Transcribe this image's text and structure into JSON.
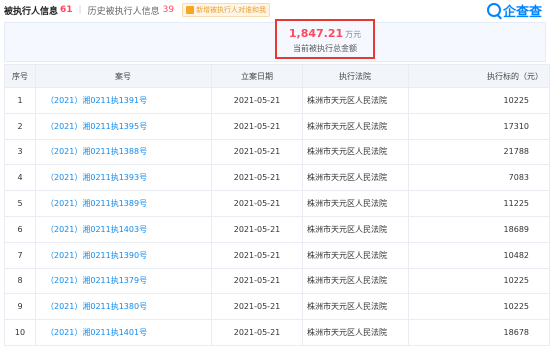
{
  "header": {
    "title": "被执行人信息",
    "title_count": "61",
    "history_label": "历史被执行人信息",
    "history_count": "39",
    "tag_label": "新增被执行人对谁和我",
    "logo_text": "企查查"
  },
  "summary": {
    "amount": "1,847.21",
    "unit": "万元",
    "label": "当前被执行总金额"
  },
  "table": {
    "headers": [
      "序号",
      "案号",
      "立案日期",
      "执行法院",
      "执行标的（元）"
    ],
    "rows": [
      {
        "idx": "1",
        "case": "（2021）湘0211执1391号",
        "date": "2021-05-21",
        "court": "株洲市天元区人民法院",
        "target": "10225"
      },
      {
        "idx": "2",
        "case": "（2021）湘0211执1395号",
        "date": "2021-05-21",
        "court": "株洲市天元区人民法院",
        "target": "17310"
      },
      {
        "idx": "3",
        "case": "（2021）湘0211执1388号",
        "date": "2021-05-21",
        "court": "株洲市天元区人民法院",
        "target": "21788"
      },
      {
        "idx": "4",
        "case": "（2021）湘0211执1393号",
        "date": "2021-05-21",
        "court": "株洲市天元区人民法院",
        "target": "7083"
      },
      {
        "idx": "5",
        "case": "（2021）湘0211执1389号",
        "date": "2021-05-21",
        "court": "株洲市天元区人民法院",
        "target": "11225"
      },
      {
        "idx": "6",
        "case": "（2021）湘0211执1403号",
        "date": "2021-05-21",
        "court": "株洲市天元区人民法院",
        "target": "18689"
      },
      {
        "idx": "7",
        "case": "（2021）湘0211执1390号",
        "date": "2021-05-21",
        "court": "株洲市天元区人民法院",
        "target": "10482"
      },
      {
        "idx": "8",
        "case": "（2021）湘0211执1379号",
        "date": "2021-05-21",
        "court": "株洲市天元区人民法院",
        "target": "10225"
      },
      {
        "idx": "9",
        "case": "（2021）湘0211执1380号",
        "date": "2021-05-21",
        "court": "株洲市天元区人民法院",
        "target": "10225"
      },
      {
        "idx": "10",
        "case": "（2021）湘0211执1401号",
        "date": "2021-05-21",
        "court": "株洲市天元区人民法院",
        "target": "18678"
      }
    ]
  },
  "colors": {
    "accent": "#128bed",
    "highlight": "#fd485e",
    "box": "#e53935"
  }
}
